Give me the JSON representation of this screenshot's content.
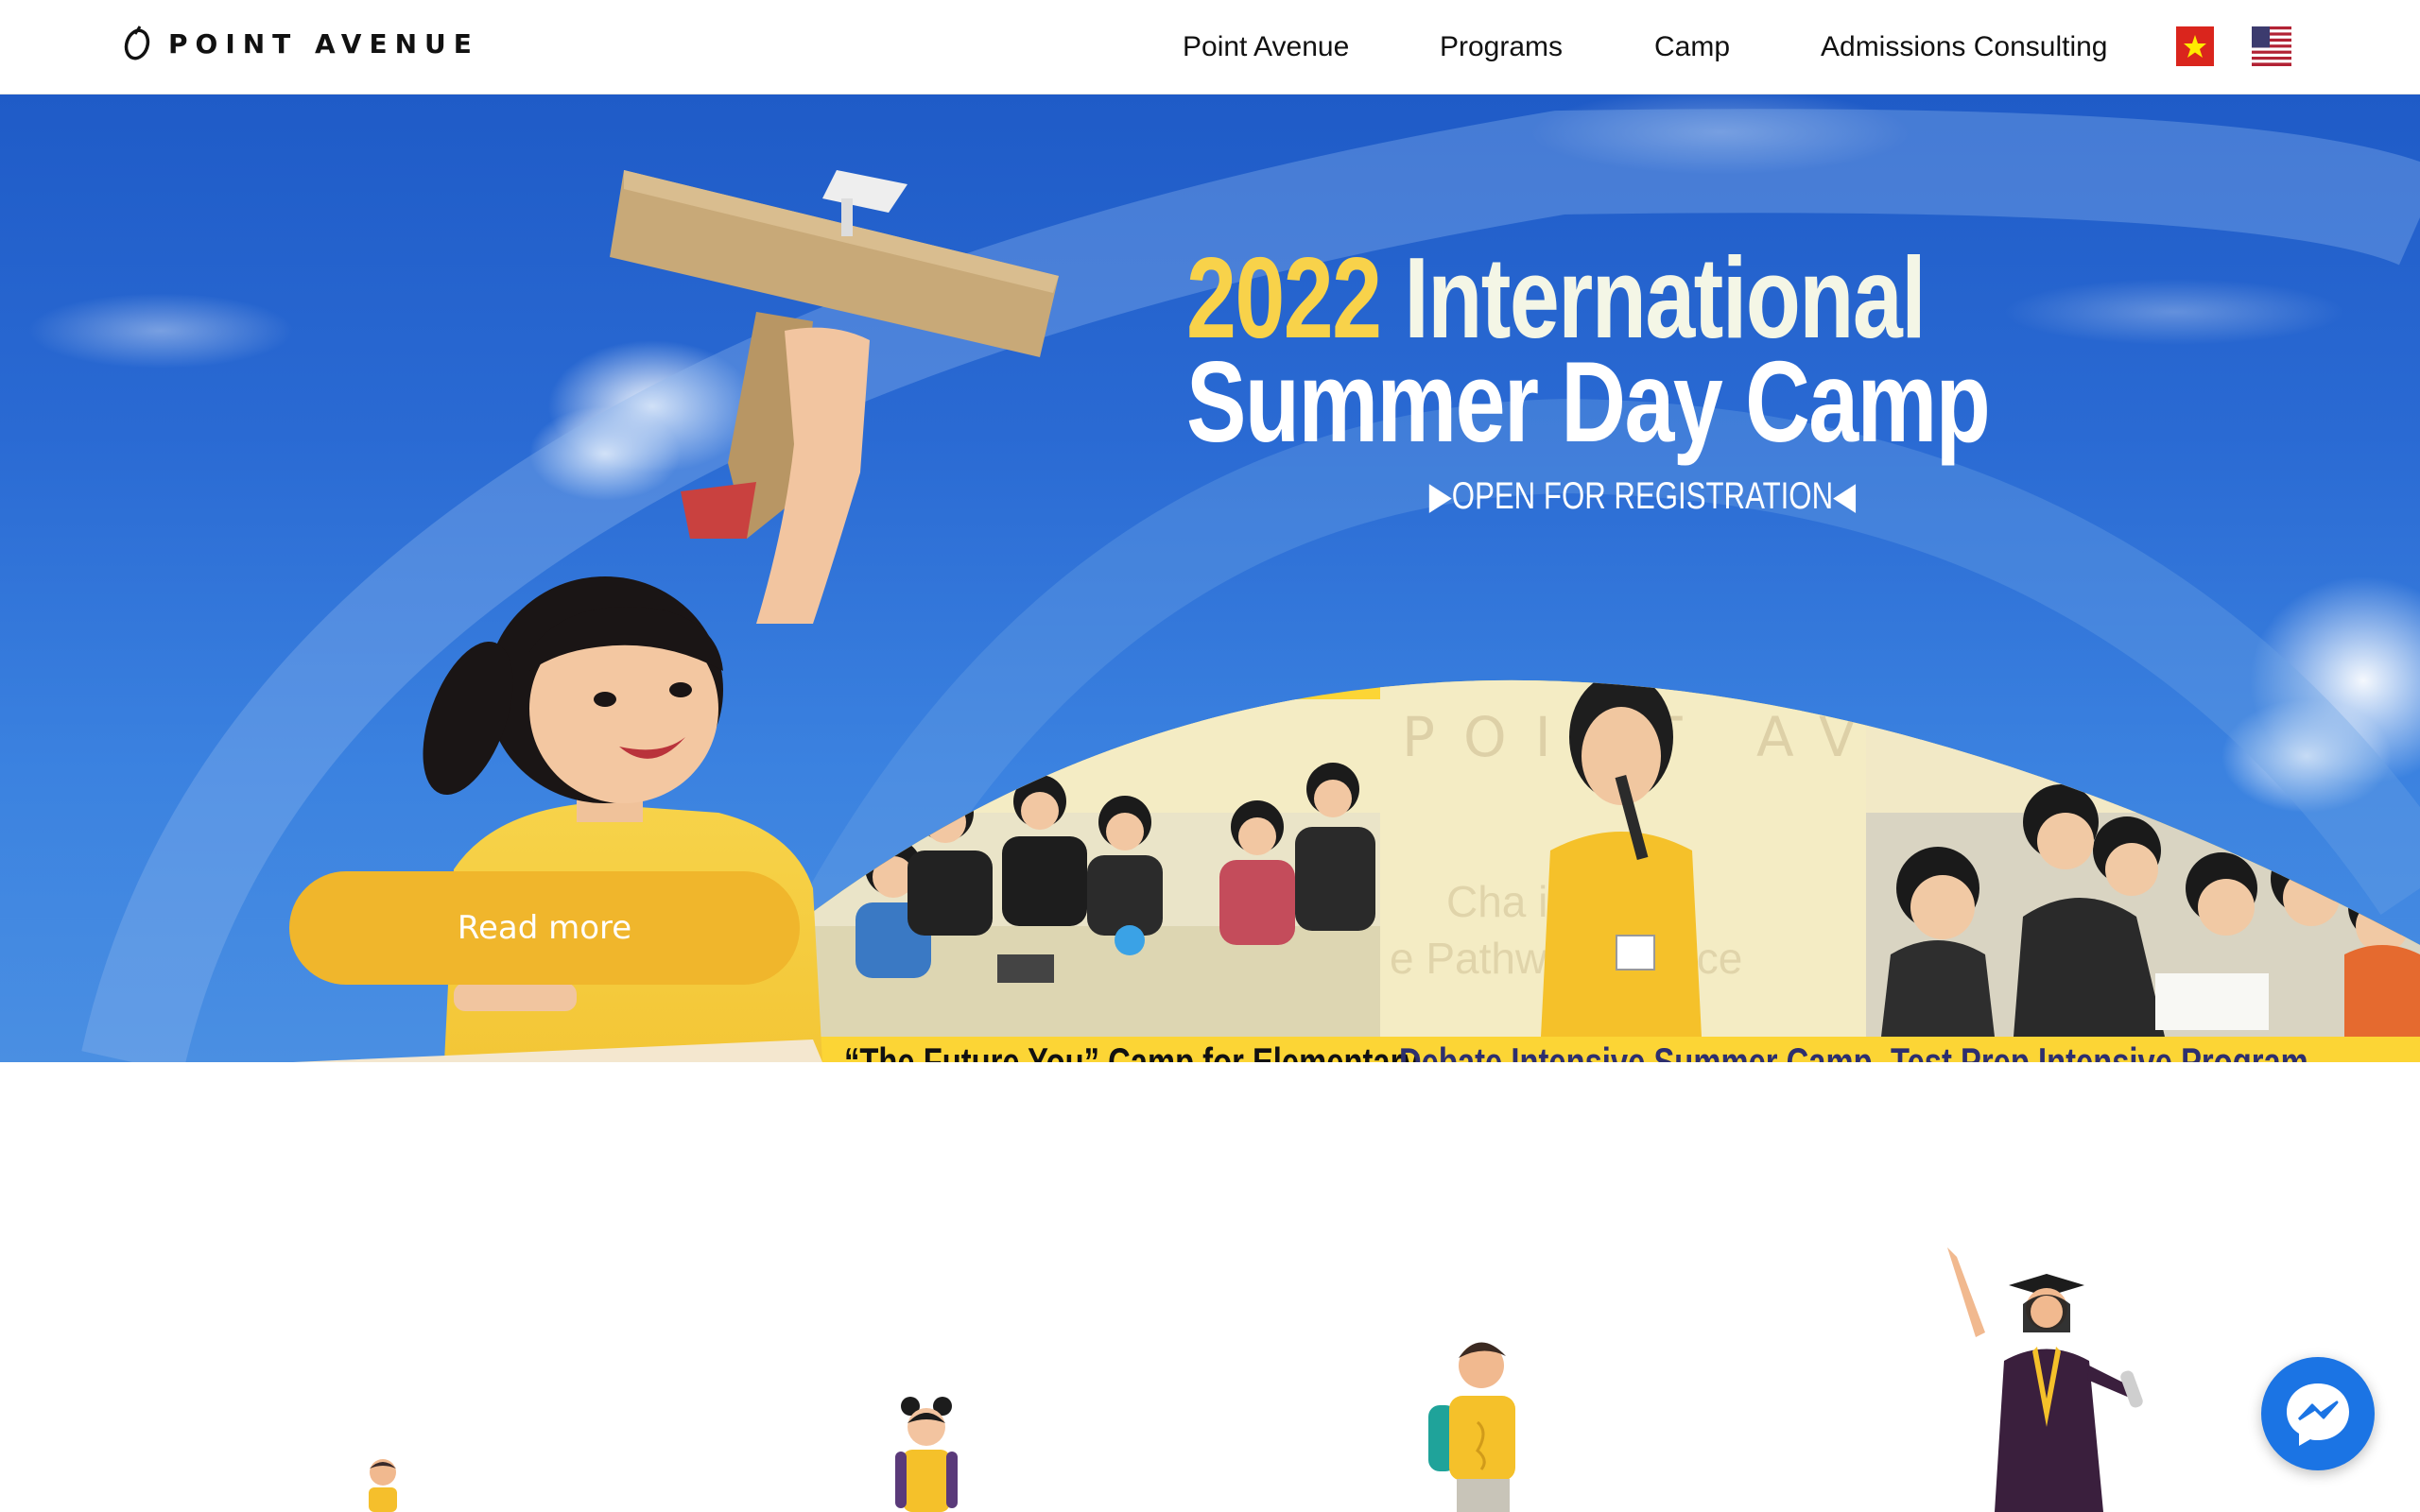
{
  "header": {
    "logo_text": "POINT AVENUE",
    "nav": [
      {
        "label": "Point Avenue"
      },
      {
        "label": "Programs"
      },
      {
        "label": "Camp"
      },
      {
        "label": "Admissions Consulting"
      }
    ],
    "languages": [
      "vietnamese-flag-icon",
      "us-flag-icon"
    ]
  },
  "hero": {
    "title_year": "2022",
    "title_rest": "International",
    "title_line2": "Summer Day Camp",
    "registration": "OPEN FOR REGISTRATION",
    "read_more": "Read more",
    "programs": [
      {
        "label": "“The Future You” Camp for Elementary"
      },
      {
        "label": "Debate Intensive Summer Camp"
      },
      {
        "label": "Test Prep Intensive Program"
      }
    ],
    "photo_backdrop_text": "POINT AVE"
  },
  "colors": {
    "accent_yellow": "#fcd535",
    "button_orange": "#f0b62c",
    "sky_blue": "#2a6ad3",
    "label_dark": "#111111",
    "label_navy": "#2d2f6e",
    "messenger_blue": "#1b74e4"
  },
  "icons": [
    "logo-mark-icon",
    "messenger-icon"
  ]
}
